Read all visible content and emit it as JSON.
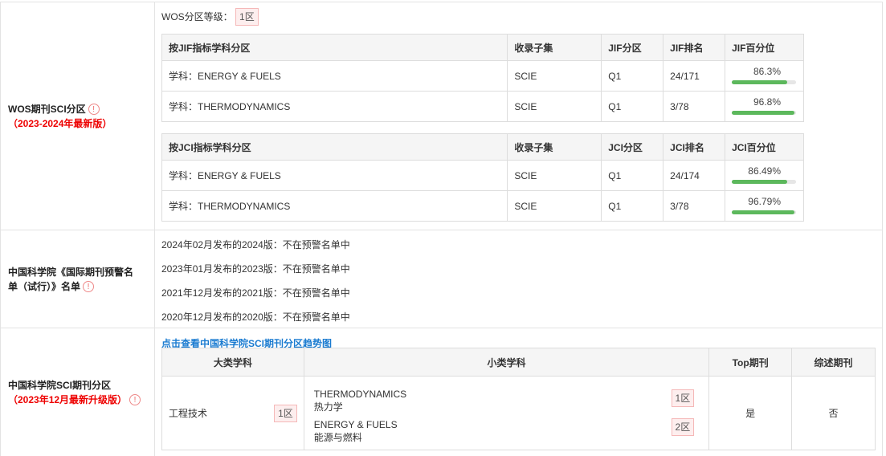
{
  "wos": {
    "label": "WOS期刊SCI分区",
    "label_year": "（2023-2024年最新版）",
    "level_label": "WOS分区等级：",
    "level_value": "1区",
    "jif_table": {
      "headers": [
        "按JIF指标学科分区",
        "收录子集",
        "JIF分区",
        "JIF排名",
        "JIF百分位"
      ],
      "rows": [
        {
          "subject": "学科：ENERGY & FUELS",
          "subset": "SCIE",
          "zone": "Q1",
          "rank": "24/171",
          "pct": "86.3%",
          "pct_value": 86.3
        },
        {
          "subject": "学科：THERMODYNAMICS",
          "subset": "SCIE",
          "zone": "Q1",
          "rank": "3/78",
          "pct": "96.8%",
          "pct_value": 96.8
        }
      ]
    },
    "jci_table": {
      "headers": [
        "按JCI指标学科分区",
        "收录子集",
        "JCI分区",
        "JCI排名",
        "JCI百分位"
      ],
      "rows": [
        {
          "subject": "学科：ENERGY & FUELS",
          "subset": "SCIE",
          "zone": "Q1",
          "rank": "24/174",
          "pct": "86.49%",
          "pct_value": 86.49
        },
        {
          "subject": "学科：THERMODYNAMICS",
          "subset": "SCIE",
          "zone": "Q1",
          "rank": "3/78",
          "pct": "96.79%",
          "pct_value": 96.79
        }
      ]
    }
  },
  "warning": {
    "label": "中国科学院《国际期刊预警名单（试行）》名单",
    "items": [
      "2024年02月发布的2024版：不在预警名单中",
      "2023年01月发布的2023版：不在预警名单中",
      "2021年12月发布的2021版：不在预警名单中",
      "2020年12月发布的2020版：不在预警名单中"
    ]
  },
  "cas": {
    "label": "中国科学院SCI期刊分区",
    "label_year": "（2023年12月最新升级版）",
    "link": "点击查看中国科学院SCI期刊分区趋势图",
    "headers": [
      "大类学科",
      "小类学科",
      "Top期刊",
      "综述期刊"
    ],
    "major": "工程技术",
    "major_zone": "1区",
    "minors": [
      {
        "en": "THERMODYNAMICS",
        "cn": "热力学",
        "zone": "1区"
      },
      {
        "en": "ENERGY & FUELS",
        "cn": "能源与燃料",
        "zone": "2区"
      }
    ],
    "top": "是",
    "review": "否"
  },
  "colors": {
    "bar": "#5cb85c",
    "accent_red": "#e00",
    "link": "#1a7bd0"
  },
  "icons": {
    "info": "info-circle-icon"
  }
}
